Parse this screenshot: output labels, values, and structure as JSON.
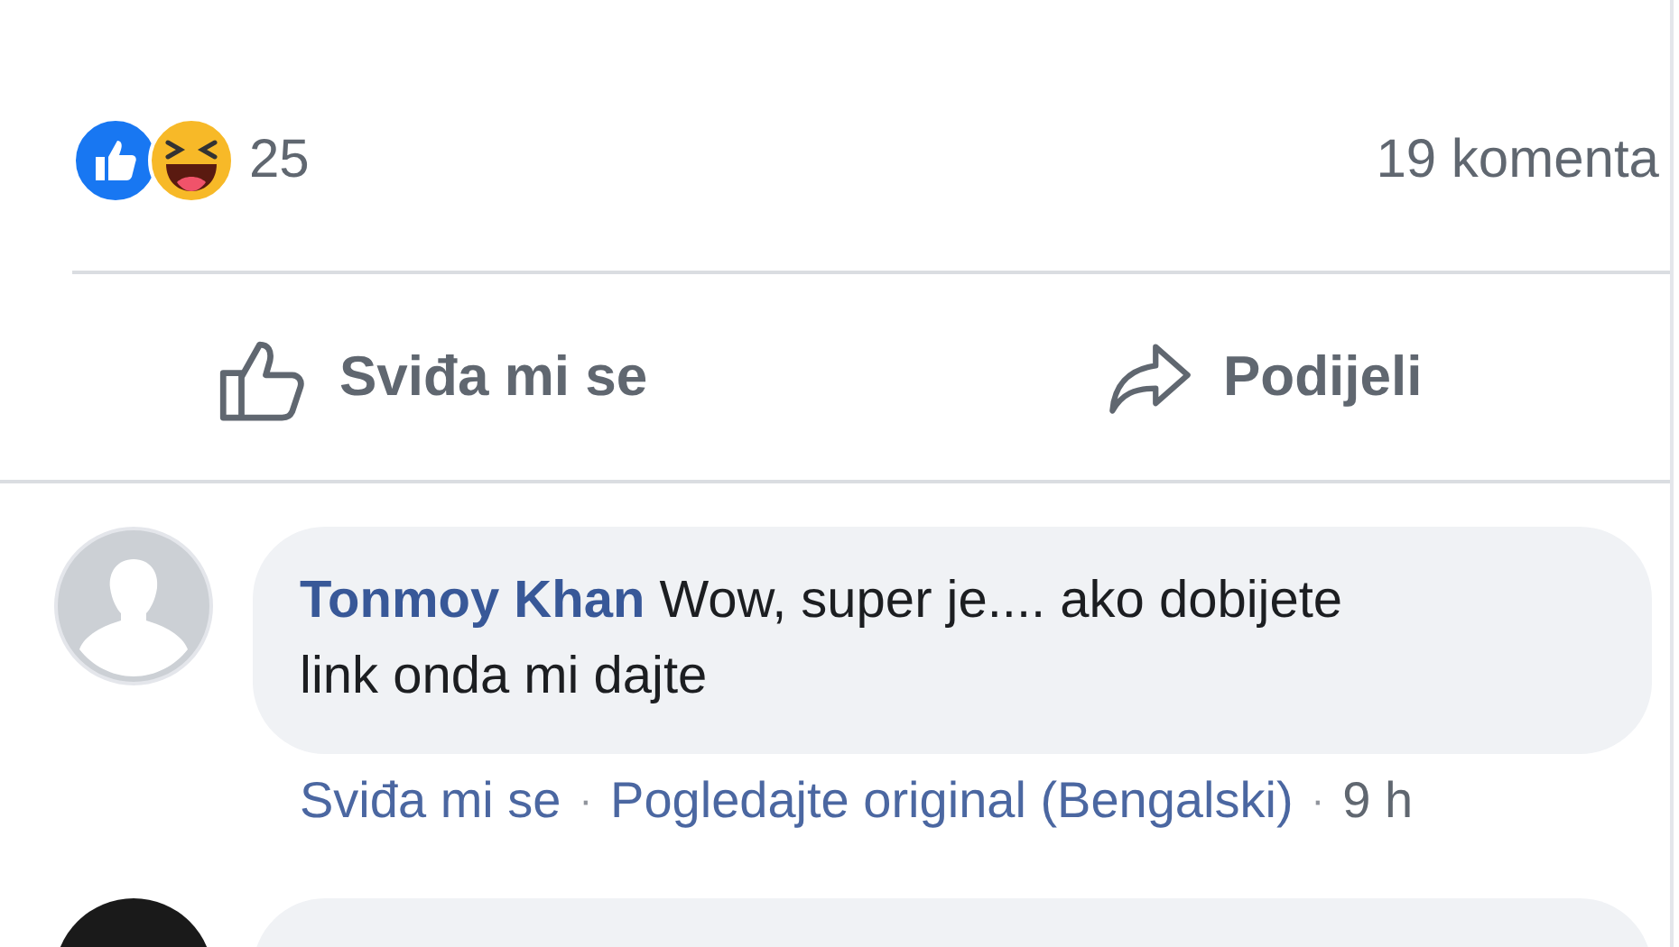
{
  "reactions": {
    "count": "25",
    "comments": "19 komenta"
  },
  "actions": [
    {
      "kind": "like",
      "label": "Sviđa mi se"
    },
    {
      "kind": "share",
      "label": "Podijeli"
    }
  ],
  "comments": [
    {
      "author": "Tonmoy Khan",
      "text": "Wow, super je.... ako dobijete link onda mi dajte",
      "links": [
        "Sviđa mi se",
        "Pogledajte original (Bengalski)"
      ],
      "separator": "·",
      "time": "9 h"
    }
  ]
}
